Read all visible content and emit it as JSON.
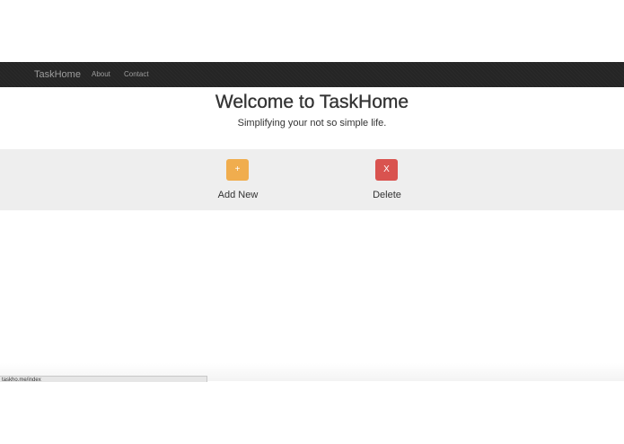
{
  "navbar": {
    "brand": "TaskHome",
    "links": [
      {
        "label": "About"
      },
      {
        "label": "Contact"
      }
    ]
  },
  "hero": {
    "title": "Welcome to TaskHome",
    "subtitle": "Simplifying your not so simple life."
  },
  "actions": {
    "add": {
      "icon_text": "+",
      "label": "Add New",
      "color": "#f0ad4e",
      "icon": "plus-icon"
    },
    "delete": {
      "icon_text": "X",
      "label": "Delete",
      "color": "#d9534f",
      "icon": "close-icon"
    }
  },
  "status_bar": {
    "url": "taskho.me/index"
  },
  "colors": {
    "navbar_bg": "#252525",
    "band_bg": "#eeeeee"
  }
}
